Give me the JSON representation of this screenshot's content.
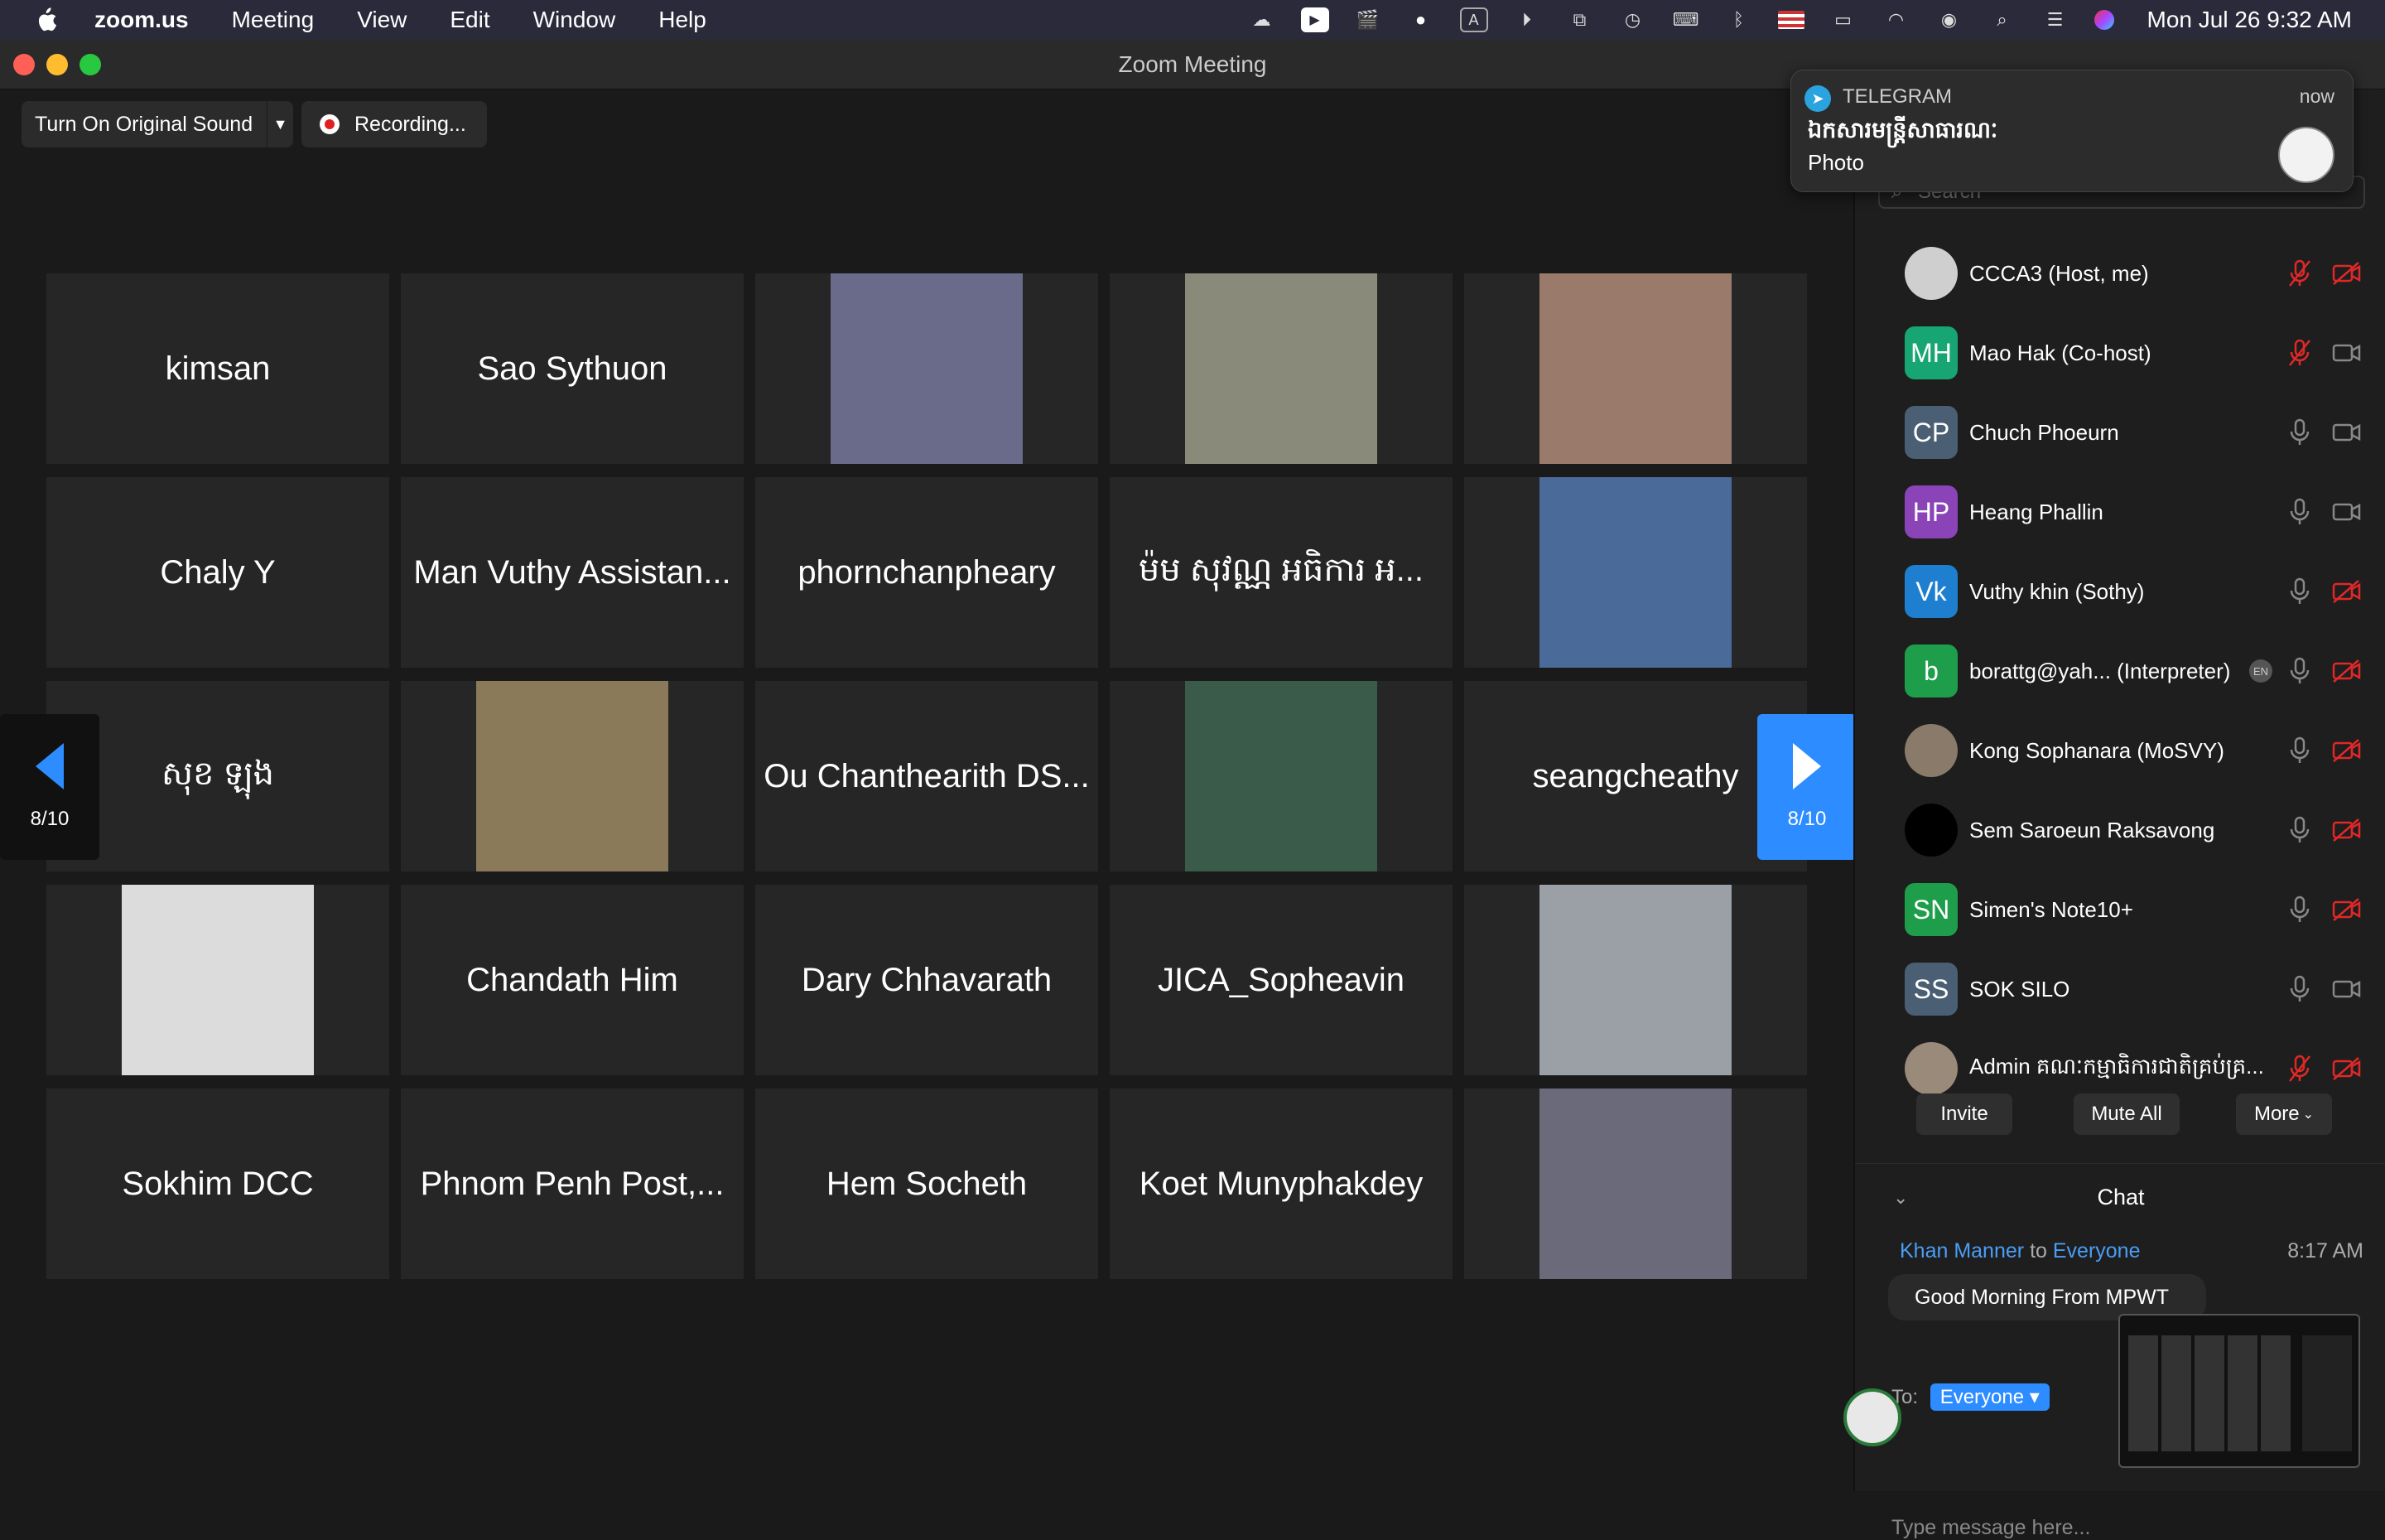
{
  "menubar": {
    "app": "zoom.us",
    "items": [
      "Meeting",
      "View",
      "Edit",
      "Window",
      "Help"
    ],
    "clock": "Mon Jul 26  9:32 AM"
  },
  "window": {
    "title": "Zoom Meeting"
  },
  "toolbar": {
    "original_sound": "Turn On Original Sound",
    "recording": "Recording..."
  },
  "gallery": {
    "tiles": [
      {
        "label": "kimsan",
        "photo": false
      },
      {
        "label": "Sao Sythuon",
        "photo": false
      },
      {
        "label": "",
        "photo": true
      },
      {
        "label": "",
        "photo": true
      },
      {
        "label": "",
        "photo": true
      },
      {
        "label": "Chaly Y",
        "photo": false
      },
      {
        "label": "Man Vuthy Assistan...",
        "photo": false
      },
      {
        "label": "phornchanpheary",
        "photo": false
      },
      {
        "label": "ម៉ម សុវណ្ណ អធិការ អ...",
        "photo": false
      },
      {
        "label": "",
        "photo": true
      },
      {
        "label": "សុខ ឡុង",
        "photo": false
      },
      {
        "label": "",
        "photo": true
      },
      {
        "label": "Ou Chanthearith DS...",
        "photo": false
      },
      {
        "label": "",
        "photo": true
      },
      {
        "label": "seangcheathy",
        "photo": false
      },
      {
        "label": "",
        "photo": true
      },
      {
        "label": "Chandath Him",
        "photo": false
      },
      {
        "label": "Dary Chhavarath",
        "photo": false
      },
      {
        "label": "JICA_Sopheavin",
        "photo": false
      },
      {
        "label": "",
        "photo": true
      },
      {
        "label": "Sokhim DCC",
        "photo": false
      },
      {
        "label": "Phnom Penh Post,...",
        "photo": false
      },
      {
        "label": "Hem Socheth",
        "photo": false
      },
      {
        "label": "Koet Munyphakdey",
        "photo": false
      },
      {
        "label": "",
        "photo": true
      }
    ],
    "page_prev": "8/10",
    "page_next": "8/10"
  },
  "notification": {
    "app": "TELEGRAM",
    "time": "now",
    "title": "ឯកសារមន្ត្រីសាធារណៈ",
    "body": "Photo"
  },
  "participants": {
    "search_placeholder": "Search",
    "list": [
      {
        "name": "CCCA3 (Host, me)",
        "initials": "",
        "color": "#cfcfcf",
        "mic": "muted",
        "cam": "off"
      },
      {
        "name": "Mao Hak (Co-host)",
        "initials": "MH",
        "color": "#17a673",
        "mic": "muted",
        "cam": "on"
      },
      {
        "name": "Chuch Phoeurn",
        "initials": "CP",
        "color": "#4a5f73",
        "mic": "on",
        "cam": "on"
      },
      {
        "name": "Heang Phallin",
        "initials": "HP",
        "color": "#8a44b8",
        "mic": "on",
        "cam": "on"
      },
      {
        "name": "Vuthy khin (Sothy)",
        "initials": "Vk",
        "color": "#1e7fd0",
        "mic": "on",
        "cam": "off"
      },
      {
        "name": "borattg@yah... (Interpreter)",
        "initials": "b",
        "color": "#1e9e4a",
        "mic": "on",
        "cam": "off",
        "badge": "EN"
      },
      {
        "name": "Kong Sophanara (MoSVY)",
        "initials": "",
        "color": "#8a7a6a",
        "mic": "on",
        "cam": "off"
      },
      {
        "name": "Sem Saroeun Raksavong",
        "initials": "",
        "color": "#000000",
        "mic": "on",
        "cam": "off"
      },
      {
        "name": "Simen's Note10+",
        "initials": "SN",
        "color": "#1e9e4a",
        "mic": "on",
        "cam": "off"
      },
      {
        "name": "SOK SILO",
        "initials": "SS",
        "color": "#4a5f73",
        "mic": "on",
        "cam": "on"
      },
      {
        "name": "Admin គណៈកម្មាធិការជាតិគ្រប់គ្រ...",
        "initials": "",
        "color": "#9a8a7a",
        "mic": "muted",
        "cam": "off"
      }
    ],
    "buttons": {
      "invite": "Invite",
      "mute_all": "Mute All",
      "more": "More"
    }
  },
  "chat": {
    "header": "Chat",
    "sender": "Khan Manner",
    "to_word": "to",
    "recipient": "Everyone",
    "time": "8:17 AM",
    "message": "Good Morning From MPWT",
    "to_label": "To:",
    "to_value": "Everyone",
    "input_placeholder": "Type message here..."
  },
  "colors": {
    "accent": "#2d8cff",
    "mic_muted": "#e02828",
    "link": "#4a9ef5"
  }
}
